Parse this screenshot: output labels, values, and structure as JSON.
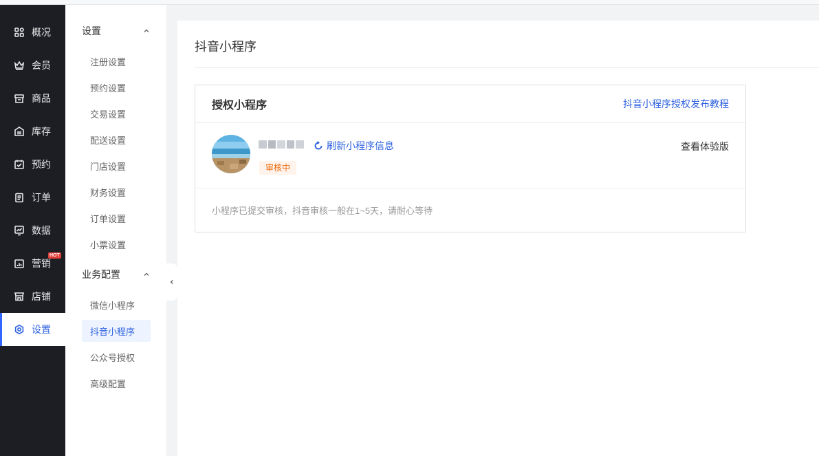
{
  "primary_nav": [
    {
      "label": "概况",
      "icon": "dashboard-icon"
    },
    {
      "label": "会员",
      "icon": "crown-icon"
    },
    {
      "label": "商品",
      "icon": "shop-bag-icon"
    },
    {
      "label": "库存",
      "icon": "inventory-icon"
    },
    {
      "label": "预约",
      "icon": "calendar-check-icon"
    },
    {
      "label": "订单",
      "icon": "clipboard-icon"
    },
    {
      "label": "数据",
      "icon": "chart-icon"
    },
    {
      "label": "营销",
      "icon": "marketing-icon",
      "badge": "HOT"
    },
    {
      "label": "店铺",
      "icon": "store-icon"
    },
    {
      "label": "设置",
      "icon": "settings-icon",
      "active": true
    }
  ],
  "secondary_nav": {
    "groups": [
      {
        "title": "设置",
        "items": [
          "注册设置",
          "预约设置",
          "交易设置",
          "配送设置",
          "门店设置",
          "财务设置",
          "订单设置",
          "小票设置"
        ]
      },
      {
        "title": "业务配置",
        "items": [
          "微信小程序",
          "抖音小程序",
          "公众号授权",
          "高级配置"
        ],
        "active_item": "抖音小程序"
      }
    ]
  },
  "main": {
    "page_title": "抖音小程序",
    "card": {
      "title": "授权小程序",
      "tutorial_link": "抖音小程序授权发布教程",
      "refresh_label": "刷新小程序信息",
      "status": "审核中",
      "trial_link": "查看体验版",
      "notice": "小程序已提交审核，抖音审核一般在1~5天，请耐心等待"
    }
  },
  "colors": {
    "accent": "#2f62e0",
    "sidebar_bg": "#1c1e23",
    "status_orange": "#ed6a0c",
    "hot_red": "#e23c39"
  }
}
